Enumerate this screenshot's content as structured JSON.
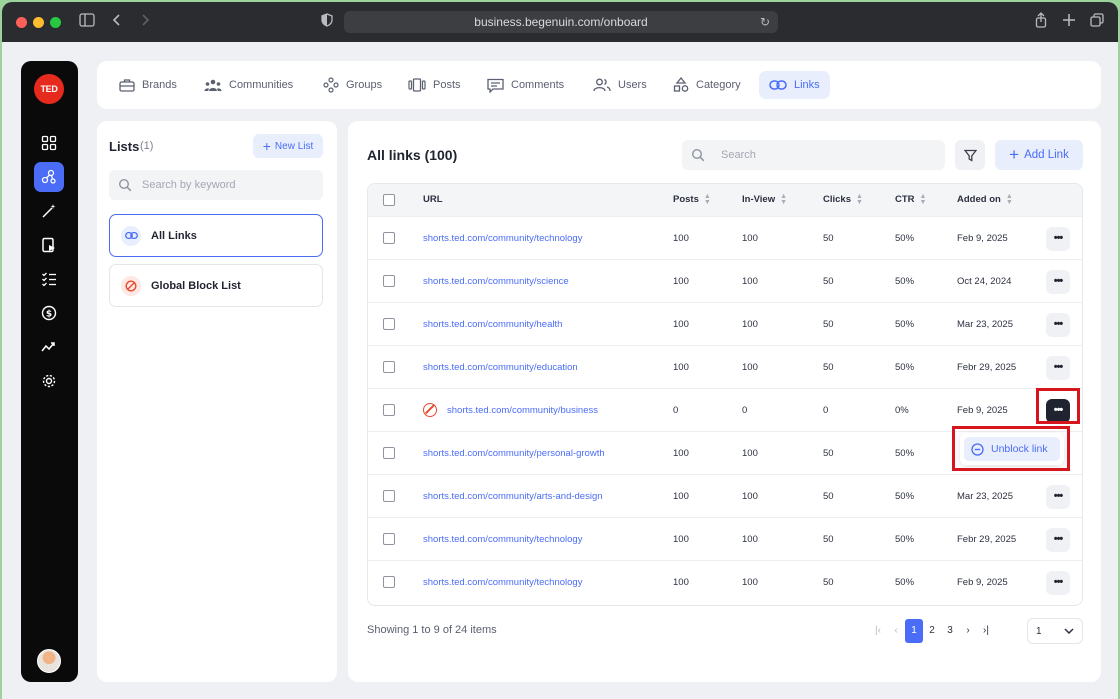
{
  "browser": {
    "url": "business.begenuin.com/onboard"
  },
  "brand": {
    "logo_text": "TED"
  },
  "topnav": {
    "tabs": [
      {
        "label": "Brands",
        "icon": "briefcase-icon"
      },
      {
        "label": "Communities",
        "icon": "people-icon"
      },
      {
        "label": "Groups",
        "icon": "groups-icon"
      },
      {
        "label": "Posts",
        "icon": "posts-icon"
      },
      {
        "label": "Comments",
        "icon": "comment-icon"
      },
      {
        "label": "Users",
        "icon": "users-icon"
      },
      {
        "label": "Category",
        "icon": "category-icon"
      },
      {
        "label": "Links",
        "icon": "link-icon",
        "active": true
      }
    ]
  },
  "lists": {
    "title": "Lists",
    "count": "(1)",
    "new_list_label": "New List",
    "search_placeholder": "Search by keyword",
    "items": [
      {
        "label": "All Links",
        "active": true
      },
      {
        "label": "Global Block List"
      }
    ]
  },
  "main": {
    "title": "All links (100)",
    "search_placeholder": "Search",
    "add_link_label": "Add Link",
    "columns": [
      "URL",
      "Posts",
      "In-View",
      "Clicks",
      "CTR",
      "Added on"
    ],
    "rows": [
      {
        "url": "shorts.ted.com/community/technology",
        "posts": "100",
        "inview": "100",
        "clicks": "50",
        "ctr": "50%",
        "added": "Feb 9, 2025"
      },
      {
        "url": "shorts.ted.com/community/science",
        "posts": "100",
        "inview": "100",
        "clicks": "50",
        "ctr": "50%",
        "added": "Oct 24, 2024"
      },
      {
        "url": "shorts.ted.com/community/health",
        "posts": "100",
        "inview": "100",
        "clicks": "50",
        "ctr": "50%",
        "added": "Mar 23, 2025"
      },
      {
        "url": "shorts.ted.com/community/education",
        "posts": "100",
        "inview": "100",
        "clicks": "50",
        "ctr": "50%",
        "added": "Febr 29, 2025"
      },
      {
        "url": "shorts.ted.com/community/business",
        "posts": "0",
        "inview": "0",
        "clicks": "0",
        "ctr": "0%",
        "added": "Feb 9, 2025",
        "blocked": true
      },
      {
        "url": "shorts.ted.com/community/personal-growth",
        "posts": "100",
        "inview": "100",
        "clicks": "50",
        "ctr": "50%",
        "added": ""
      },
      {
        "url": "shorts.ted.com/community/arts-and-design",
        "posts": "100",
        "inview": "100",
        "clicks": "50",
        "ctr": "50%",
        "added": "Mar 23, 2025"
      },
      {
        "url": "shorts.ted.com/community/technology",
        "posts": "100",
        "inview": "100",
        "clicks": "50",
        "ctr": "50%",
        "added": "Febr 29, 2025"
      },
      {
        "url": "shorts.ted.com/community/technology",
        "posts": "100",
        "inview": "100",
        "clicks": "50",
        "ctr": "50%",
        "added": "Feb 9, 2025"
      }
    ],
    "more_label": "•••",
    "context_menu": {
      "unblock_label": "Unblock link"
    },
    "footer": {
      "showing": "Showing 1 to 9 of 24 items",
      "pages": [
        "1",
        "2",
        "3"
      ],
      "current_page": "1",
      "first": "|‹",
      "prev": "‹",
      "next": "›",
      "last": "›|",
      "page_select_value": "1"
    }
  },
  "colors": {
    "accent": "#4a6cf7",
    "danger": "#e84a32",
    "highlight": "#d6161f",
    "rail": "#0a0a0a"
  }
}
